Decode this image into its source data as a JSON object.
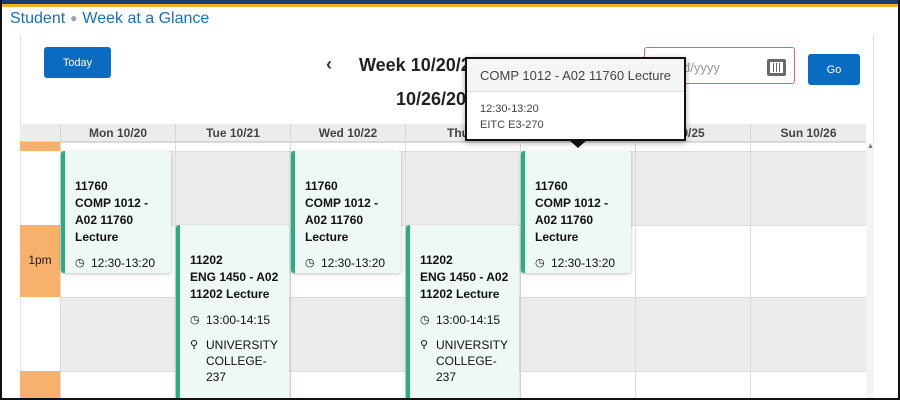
{
  "breadcrumb": {
    "root": "Student",
    "current": "Week at a Glance"
  },
  "toolbar": {
    "today_label": "Today",
    "prev_icon": "chevron-left-icon",
    "week_title_line1": "Week 10/20/2",
    "week_title_line2": "10/26/20",
    "date_placeholder_visible": "d/yyyy",
    "go_label": "Go"
  },
  "days": [
    "Mon 10/20",
    "Tue 10/21",
    "Wed 10/22",
    "Thu 1",
    "",
    "0/25",
    "Sun 10/26"
  ],
  "time_labels": {
    "one_pm": "1pm"
  },
  "events": [
    {
      "id": "mon",
      "title": "11760\nCOMP 1012 -\nA02 11760\nLecture",
      "time": "12:30-13:20"
    },
    {
      "id": "tue",
      "title": "11202\nENG 1450 - A02\n11202 Lecture",
      "time": "13:00-14:15",
      "location": "UNIVERSITY COLLEGE-237"
    },
    {
      "id": "wed",
      "title": "11760\nCOMP 1012 -\nA02 11760\nLecture",
      "time": "12:30-13:20"
    },
    {
      "id": "thu",
      "title": "11202\nENG 1450 - A02\n11202 Lecture",
      "time": "13:00-14:15",
      "location": "UNIVERSITY COLLEGE-237"
    },
    {
      "id": "fri",
      "title": "11760\nCOMP 1012 -\nA02 11760\nLecture",
      "time": "12:30-13:20"
    }
  ],
  "popover": {
    "title": "COMP 1012 - A02 11760 Lecture",
    "time": "12:30-13:20",
    "location": "EITC E3-270"
  },
  "colors": {
    "accent": "#0a6bc2",
    "event_border": "#27ae82",
    "event_bg": "#eef8f4",
    "time_col": "#f8b06d",
    "header_bar": "#1f3b6e",
    "header_stripe": "#f0b323"
  }
}
